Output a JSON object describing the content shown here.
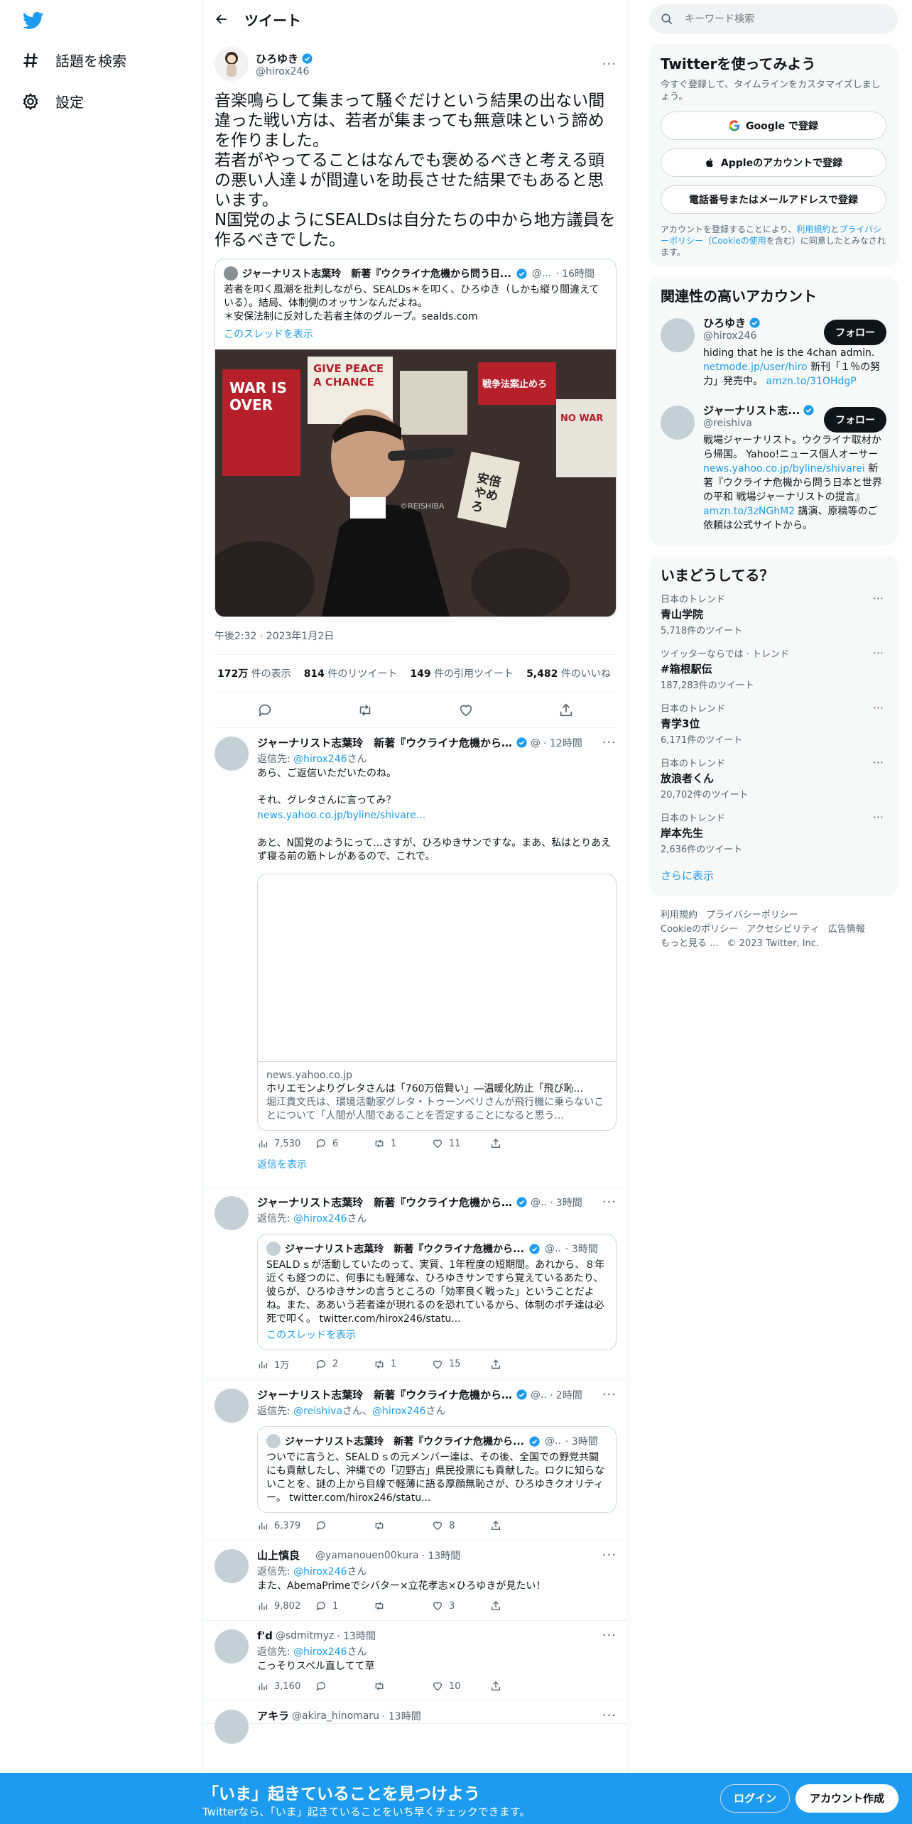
{
  "nav": {
    "explore_label": "話題を検索",
    "settings_label": "設定"
  },
  "header": {
    "title": "ツイート"
  },
  "tweet": {
    "name": "ひろゆき",
    "handle": "@hirox246",
    "text": "音楽鳴らして集まって騒ぐだけという結果の出ない間違った戦い方は、若者が集まっても無意味という諦めを作りました。\n若者がやってることはなんでも褒めるべきと考える頭の悪い人達↓が間違いを助長させた結果でもあると思います。\nN国党のようにSEALDsは自分たちの中から地方議員を作るべきでした。",
    "quote": {
      "name": "ジャーナリスト志葉玲　新著『ウクライナ危機から問う日...",
      "handle": "@...",
      "time": "· 16時間",
      "text": "若者を叩く風潮を批判しながら、SEALDs＊を叩く、ひろゆき（しかも縦り間違えている）。結局、体制側のオッサンなんだよね。\n＊安保法制に反対した若者主体のグループ。sealds.com",
      "thread_link": "このスレッドを表示",
      "photo_sign_1": "WAR IS OVER",
      "photo_sign_2": "GIVE PEACE A CHANCE",
      "photo_sign_3": "安倍やめろ",
      "photo_sign_4": "NO WAR",
      "photo_sign_5": "戦争法案止めろ",
      "photo_credit": "©REISHIBA"
    },
    "timestamp": "午後2:32 · 2023年1月2日",
    "stats": {
      "views": "172万",
      "views_label": "件の表示",
      "retweets": "814",
      "retweets_label": "件のリツイート",
      "quotes": "149",
      "quotes_label": "件の引用ツイート",
      "likes": "5,482",
      "likes_label": "件のいいね"
    }
  },
  "replies": [
    {
      "name": "ジャーナリスト志葉玲　新著『ウクライナ危機から...",
      "handle": "@",
      "time": "· 12時間",
      "reply_to_prefix": "返信先: ",
      "reply_to": "@hirox246",
      "reply_to_suffix": "さん",
      "text": "あら、ご返信いただいたのね。\n\nそれ、グレタさんに言ってみ？",
      "link": "news.yahoo.co.jp/byline/shivare...",
      "text2": "あと、N国党のようにって...さすが、ひろゆきサンですな。まあ、私はとりあえず寝る前の筋トレがあるので、これで。",
      "card": {
        "domain": "news.yahoo.co.jp",
        "title": "ホリエモンよりグレタさんは「760万倍賢い」―温暖化防止「飛び恥...",
        "desc": "堀江貴文氏は、環境活動家グレタ・トゥーンベリさんが飛行機に乗らないことについて「人間が人間であることを否定することになると思う..."
      },
      "views": "7,530",
      "replies": "6",
      "retweets": "1",
      "likes": "11"
    },
    {
      "name": "ジャーナリスト志葉玲　新著『ウクライナ危機から...",
      "handle": "@..",
      "time": "· 3時間",
      "reply_to_prefix": "返信先: ",
      "reply_to": "@hirox246",
      "reply_to_suffix": "さん",
      "quote": {
        "name": "ジャーナリスト志葉玲　新著『ウクライナ危機から...",
        "handle": "@..",
        "time": "· 3時間",
        "text": "SEALＤｓが活動していたのって、実質、1年程度の短期間。あれから、８年近くも経つのに、何事にも軽薄な、ひろゆきサンですら覚えているあたり、彼らが、ひろゆきサンの言うところの「効率良く戦った」ということだよね。また、ああいう若者達が現れるのを恐れているから、体制のポチ達は必死で叩く。 twitter.com/hirox246/statu...",
        "thread_link": "このスレッドを表示"
      },
      "views": "1万",
      "replies": "2",
      "retweets": "1",
      "likes": "15"
    },
    {
      "name": "ジャーナリスト志葉玲　新著『ウクライナ危機から...",
      "handle": "@..",
      "time": "· 2時間",
      "reply_to_prefix": "返信先: ",
      "reply_to": "@reishiva",
      "reply_to_mid": "さん、",
      "reply_to2": "@hirox246",
      "reply_to_suffix": "さん",
      "quote": {
        "name": "ジャーナリスト志葉玲　新著『ウクライナ危機から...",
        "handle": "@..",
        "time": "· 3時間",
        "text": "ついでに言うと、SEALＤｓの元メンバー達は、その後、全国での野党共闘にも貢献したし、沖縄での「辺野古」県民投票にも貢献した。ロクに知らないことを、謎の上から目線で軽薄に語る厚顔無恥さが、ひろゆきクオリティー。 twitter.com/hirox246/statu..."
      },
      "views": "6,379",
      "replies": "",
      "retweets": "",
      "likes": "8"
    },
    {
      "name": "山上慎良",
      "handle": "@yamanouen00kura",
      "time": "· 13時間",
      "reply_to_prefix": "返信先: ",
      "reply_to": "@hirox246",
      "reply_to_suffix": "さん",
      "text": "また、AbemaPrimeでシバター×立花孝志×ひろゆきが見たい！",
      "views": "9,802",
      "replies": "1",
      "retweets": "",
      "likes": "3"
    },
    {
      "name": "f'd",
      "handle": "@sdmitmyz",
      "time": "· 13時間",
      "reply_to_prefix": "返信先: ",
      "reply_to": "@hirox246",
      "reply_to_suffix": "さん",
      "text": "こっそりスペル直してて草",
      "views": "3,160",
      "replies": "",
      "retweets": "",
      "likes": "10"
    },
    {
      "name": "アキラ",
      "handle": "@akira_hinomaru",
      "time": "· 13時間"
    }
  ],
  "show_replies": "返信を表示",
  "right": {
    "search_placeholder": "キーワード検索",
    "signup": {
      "title": "Twitterを使ってみよう",
      "sub": "今すぐ登録して、タイムラインをカスタマイズしましょう。",
      "google": "Google で登録",
      "apple": "Appleのアカウントで登録",
      "phone": "電話番号またはメールアドレスで登録",
      "legal_1": "アカウントを登録することにより、",
      "legal_terms": "利用規約",
      "legal_2": "と",
      "legal_privacy": "プライバシーポリシー",
      "legal_3": "（",
      "legal_cookie": "Cookieの使用",
      "legal_4": "を含む）に同意したとみなされます。"
    },
    "related": {
      "title": "関連性の高いアカウント",
      "follow": "フォロー",
      "accounts": [
        {
          "name": "ひろゆき",
          "handle": "@hirox246",
          "bio1": "hiding that he is the 4chan admin.",
          "link1": "netmode.jp/user/hiro",
          "bio2": " 新刊「１％の努力」発売中。 ",
          "link2": "amzn.to/31OHdgP"
        },
        {
          "name": "ジャーナリスト志...",
          "handle": "@reishiva",
          "bio1": "戦場ジャーナリスト。ウクライナ取材から帰国。 Yahoo!ニュース個人オーサー ",
          "link1": "news.yahoo.co.jp/byline/shivarei",
          "bio2": " 新著『ウクライナ危機から問う日本と世界の平和 戦場ジャーナリストの提言』 ",
          "link2": "amzn.to/3zNGhM2",
          "bio3": " 講演、原稿等のご依頼は公式サイトから。"
        }
      ]
    },
    "trends": {
      "title": "いまどうしてる？",
      "items": [
        {
          "context": "日本のトレンド",
          "name": "青山学院",
          "count": "5,718件のツイート"
        },
        {
          "context": "ツイッターならでは · トレンド",
          "name": "#箱根駅伝",
          "count": "187,283件のツイート"
        },
        {
          "context": "日本のトレンド",
          "name": "青学3位",
          "count": "6,171件のツイート"
        },
        {
          "context": "日本のトレンド",
          "name": "放浪者くん",
          "count": "20,702件のツイート"
        },
        {
          "context": "日本のトレンド",
          "name": "岸本先生",
          "count": "2,636件のツイート"
        }
      ],
      "show_more": "さらに表示"
    },
    "footer": {
      "terms": "利用規約",
      "privacy": "プライバシーポリシー",
      "cookie": "Cookieのポリシー",
      "access": "アクセシビリティ",
      "ads": "広告情報",
      "more": "もっと見る ...",
      "copyright": "© 2023 Twitter, Inc."
    }
  },
  "banner": {
    "title": "「いま」起きていることを見つけよう",
    "sub": "Twitterなら、「いま」起きていることをいち早くチェックできます。",
    "login": "ログイン",
    "signup": "アカウント作成"
  }
}
